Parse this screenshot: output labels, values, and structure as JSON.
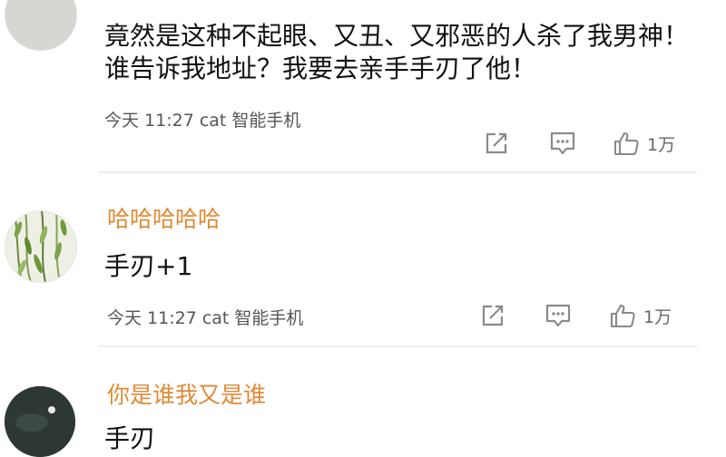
{
  "comments": [
    {
      "text_lines": [
        "竟然是这种不起眼、又丑、又邪恶的人杀了我男神！",
        "谁告诉我地址？我要去亲手手刃了他！"
      ],
      "time": "今天 11:27",
      "device": "cat 智能手机",
      "likes": "1万"
    },
    {
      "username": "哈哈哈哈哈",
      "text": "手刃+1",
      "time": "今天 11:27",
      "device": "cat 智能手机",
      "likes": "1万"
    },
    {
      "username": "你是谁我又是谁",
      "text": "手刃"
    }
  ],
  "icons": {
    "share": "share-icon",
    "comment": "comment-icon",
    "like": "thumbs-up-icon"
  },
  "colors": {
    "username": "#e08a35",
    "meta": "#555555",
    "icon": "#888888"
  }
}
